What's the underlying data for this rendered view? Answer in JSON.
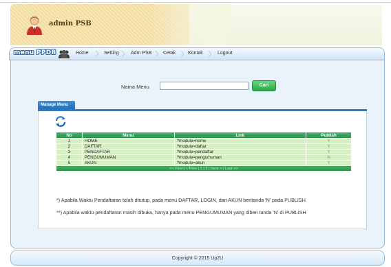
{
  "header": {
    "brand": "admin PSB"
  },
  "nav": {
    "logo": "menu PPDB",
    "items": [
      "Home",
      "Setting",
      "Adm PSB",
      "Cetak",
      "Kontak",
      "Logout"
    ]
  },
  "search": {
    "label": "Nama Menu",
    "value": "",
    "button": "Cari"
  },
  "tab": {
    "label": "Manage Menu"
  },
  "table": {
    "headers": [
      "No",
      "Menu",
      "Link",
      "Publish"
    ],
    "rows": [
      {
        "no": "1",
        "menu": "HOME",
        "link": "?module=home",
        "publish": "Y"
      },
      {
        "no": "2",
        "menu": "DAFTAR",
        "link": "?module=daftar",
        "publish": "Y"
      },
      {
        "no": "3",
        "menu": "PENDAFTAR",
        "link": "?module=pendaftar",
        "publish": "Y"
      },
      {
        "no": "4",
        "menu": "PENGUMUMAN",
        "link": "?module=pengumuman",
        "publish": "N"
      },
      {
        "no": "5",
        "menu": "AKUN",
        "link": "?module=akun",
        "publish": "Y"
      }
    ],
    "pager": "<< First | < Prev | 1 | 2 | Next > | Last >>"
  },
  "notes": [
    "*) Apabila Waktu Pendaftaran telah ditutup, pada menu DAFTAR, LOGIN, dan AKUN beritanda 'N' pada PUBLISH",
    "**) Apabila waktu pendaftaran masih dibuka, hanya pada menu PENGUMUMAN yang diberi tanda 'N' di PUBLISH"
  ],
  "footer": {
    "copyright": "Copyright © 2015 Up2U"
  },
  "colors": {
    "accent": "#2a7cc5",
    "table_header": "#2a8f4d",
    "row_bg": "#d6f0c4",
    "button": "#2fa64a"
  }
}
